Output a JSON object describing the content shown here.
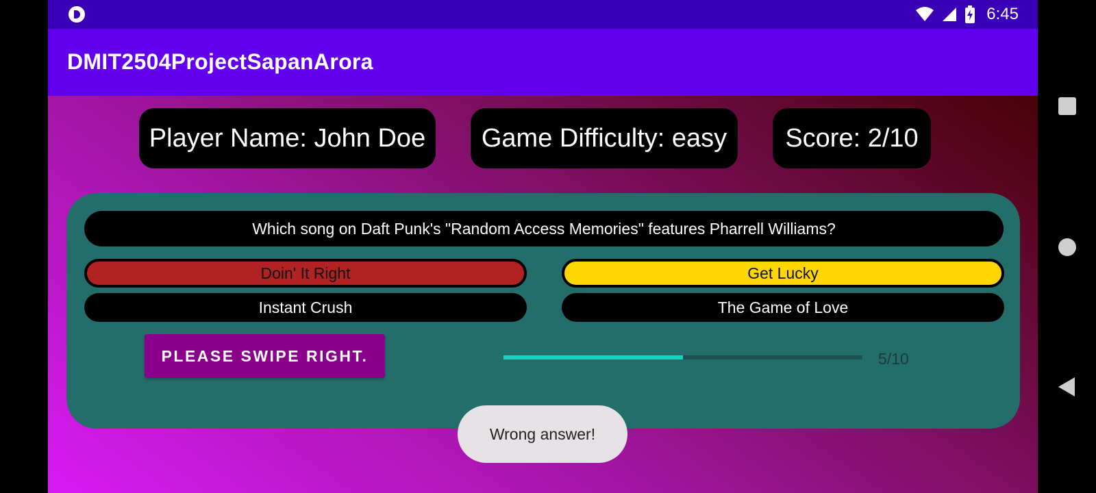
{
  "status_bar": {
    "time": "6:45",
    "icons": [
      "app-notification-icon",
      "wifi-icon",
      "cell-signal-icon",
      "battery-charging-icon"
    ]
  },
  "app_bar": {
    "title": "DMIT2504ProjectSapanArora"
  },
  "info": {
    "player": "Player Name: John Doe",
    "difficulty": "Game Difficulty: easy",
    "score": "Score: 2/10"
  },
  "quiz": {
    "question": "Which song on Daft Punk's \"Random Access Memories\" features Pharrell Williams?",
    "answers": [
      {
        "label": "Doin' It Right",
        "state": "wrong"
      },
      {
        "label": "Get Lucky",
        "state": "correct"
      },
      {
        "label": "Instant Crush",
        "state": "default"
      },
      {
        "label": "The Game of Love",
        "state": "default"
      }
    ],
    "swipe_button": "PLEASE SWIPE RIGHT.",
    "progress": {
      "current": 5,
      "total": 10,
      "label": "5/10"
    }
  },
  "toast": {
    "message": "Wrong answer!"
  },
  "colors": {
    "status_bar": "#3a00b8",
    "app_bar": "#6200ee",
    "card": "#236d6a",
    "wrong_answer": "#b22222",
    "correct_answer": "#ffd700",
    "swipe_button": "#8b008b",
    "progress_fill": "#19d3bf"
  },
  "nav_bar": {
    "icons": [
      "recents-icon",
      "home-icon",
      "back-icon"
    ]
  }
}
